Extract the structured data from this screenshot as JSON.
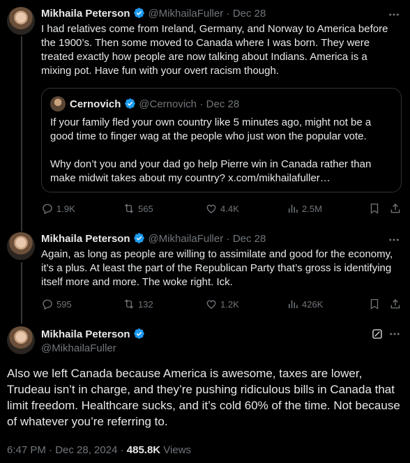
{
  "tweet1": {
    "name": "Mikhaila Peterson",
    "handle": "@MikhailaFuller",
    "date": "· Dec 28",
    "text": "I had relatives come from Ireland, Germany, and Norway to America before the 1900’s. Then some moved to Canada where I was born. They were treated exactly how people are now talking about Indians. America is a mixing pot. Have fun with your overt racism though.",
    "quote": {
      "name": "Cernovich",
      "handle": "@Cernovich",
      "date": "· Dec 28",
      "text1": "If your family fled your own country like 5 minutes ago, might not be a good time to finger wag at the people who just won the popular vote.",
      "text2": "Why don’t you and your dad go help Pierre win in Canada rather than make midwit takes about my country? x.com/mikhailafuller…"
    },
    "replies": "1.9K",
    "reposts": "565",
    "likes": "4.4K",
    "views": "2.5M"
  },
  "tweet2": {
    "name": "Mikhaila Peterson",
    "handle": "@MikhailaFuller",
    "date": "· Dec 28",
    "text": "Again, as long as people are willing to assimilate and good for the economy, it’s a plus. At least the part of the Republican Party that’s gross is identifying itself more and more. The woke right. Ick.",
    "replies": "595",
    "reposts": "132",
    "likes": "1.2K",
    "views": "426K"
  },
  "main": {
    "name": "Mikhaila Peterson",
    "handle": "@MikhailaFuller",
    "text": "Also we left Canada because America is awesome, taxes are lower, Trudeau isn’t in charge, and they’re pushing ridiculous bills in Canada that limit freedom. Healthcare sucks, and it’s cold 60% of the time. Not because of whatever you’re referring to.",
    "time": "6:47 PM · Dec 28, 2024 · ",
    "views_count": "485.8K",
    "views_label": " Views"
  },
  "colors": {
    "verified": "#1d9bf0",
    "muted": "#71767b",
    "text": "#e7e9ea",
    "border": "#2f3336"
  },
  "icons": [
    "verified-icon",
    "reply-icon",
    "repost-icon",
    "like-icon",
    "views-icon",
    "bookmark-icon",
    "share-icon",
    "grok-icon"
  ]
}
